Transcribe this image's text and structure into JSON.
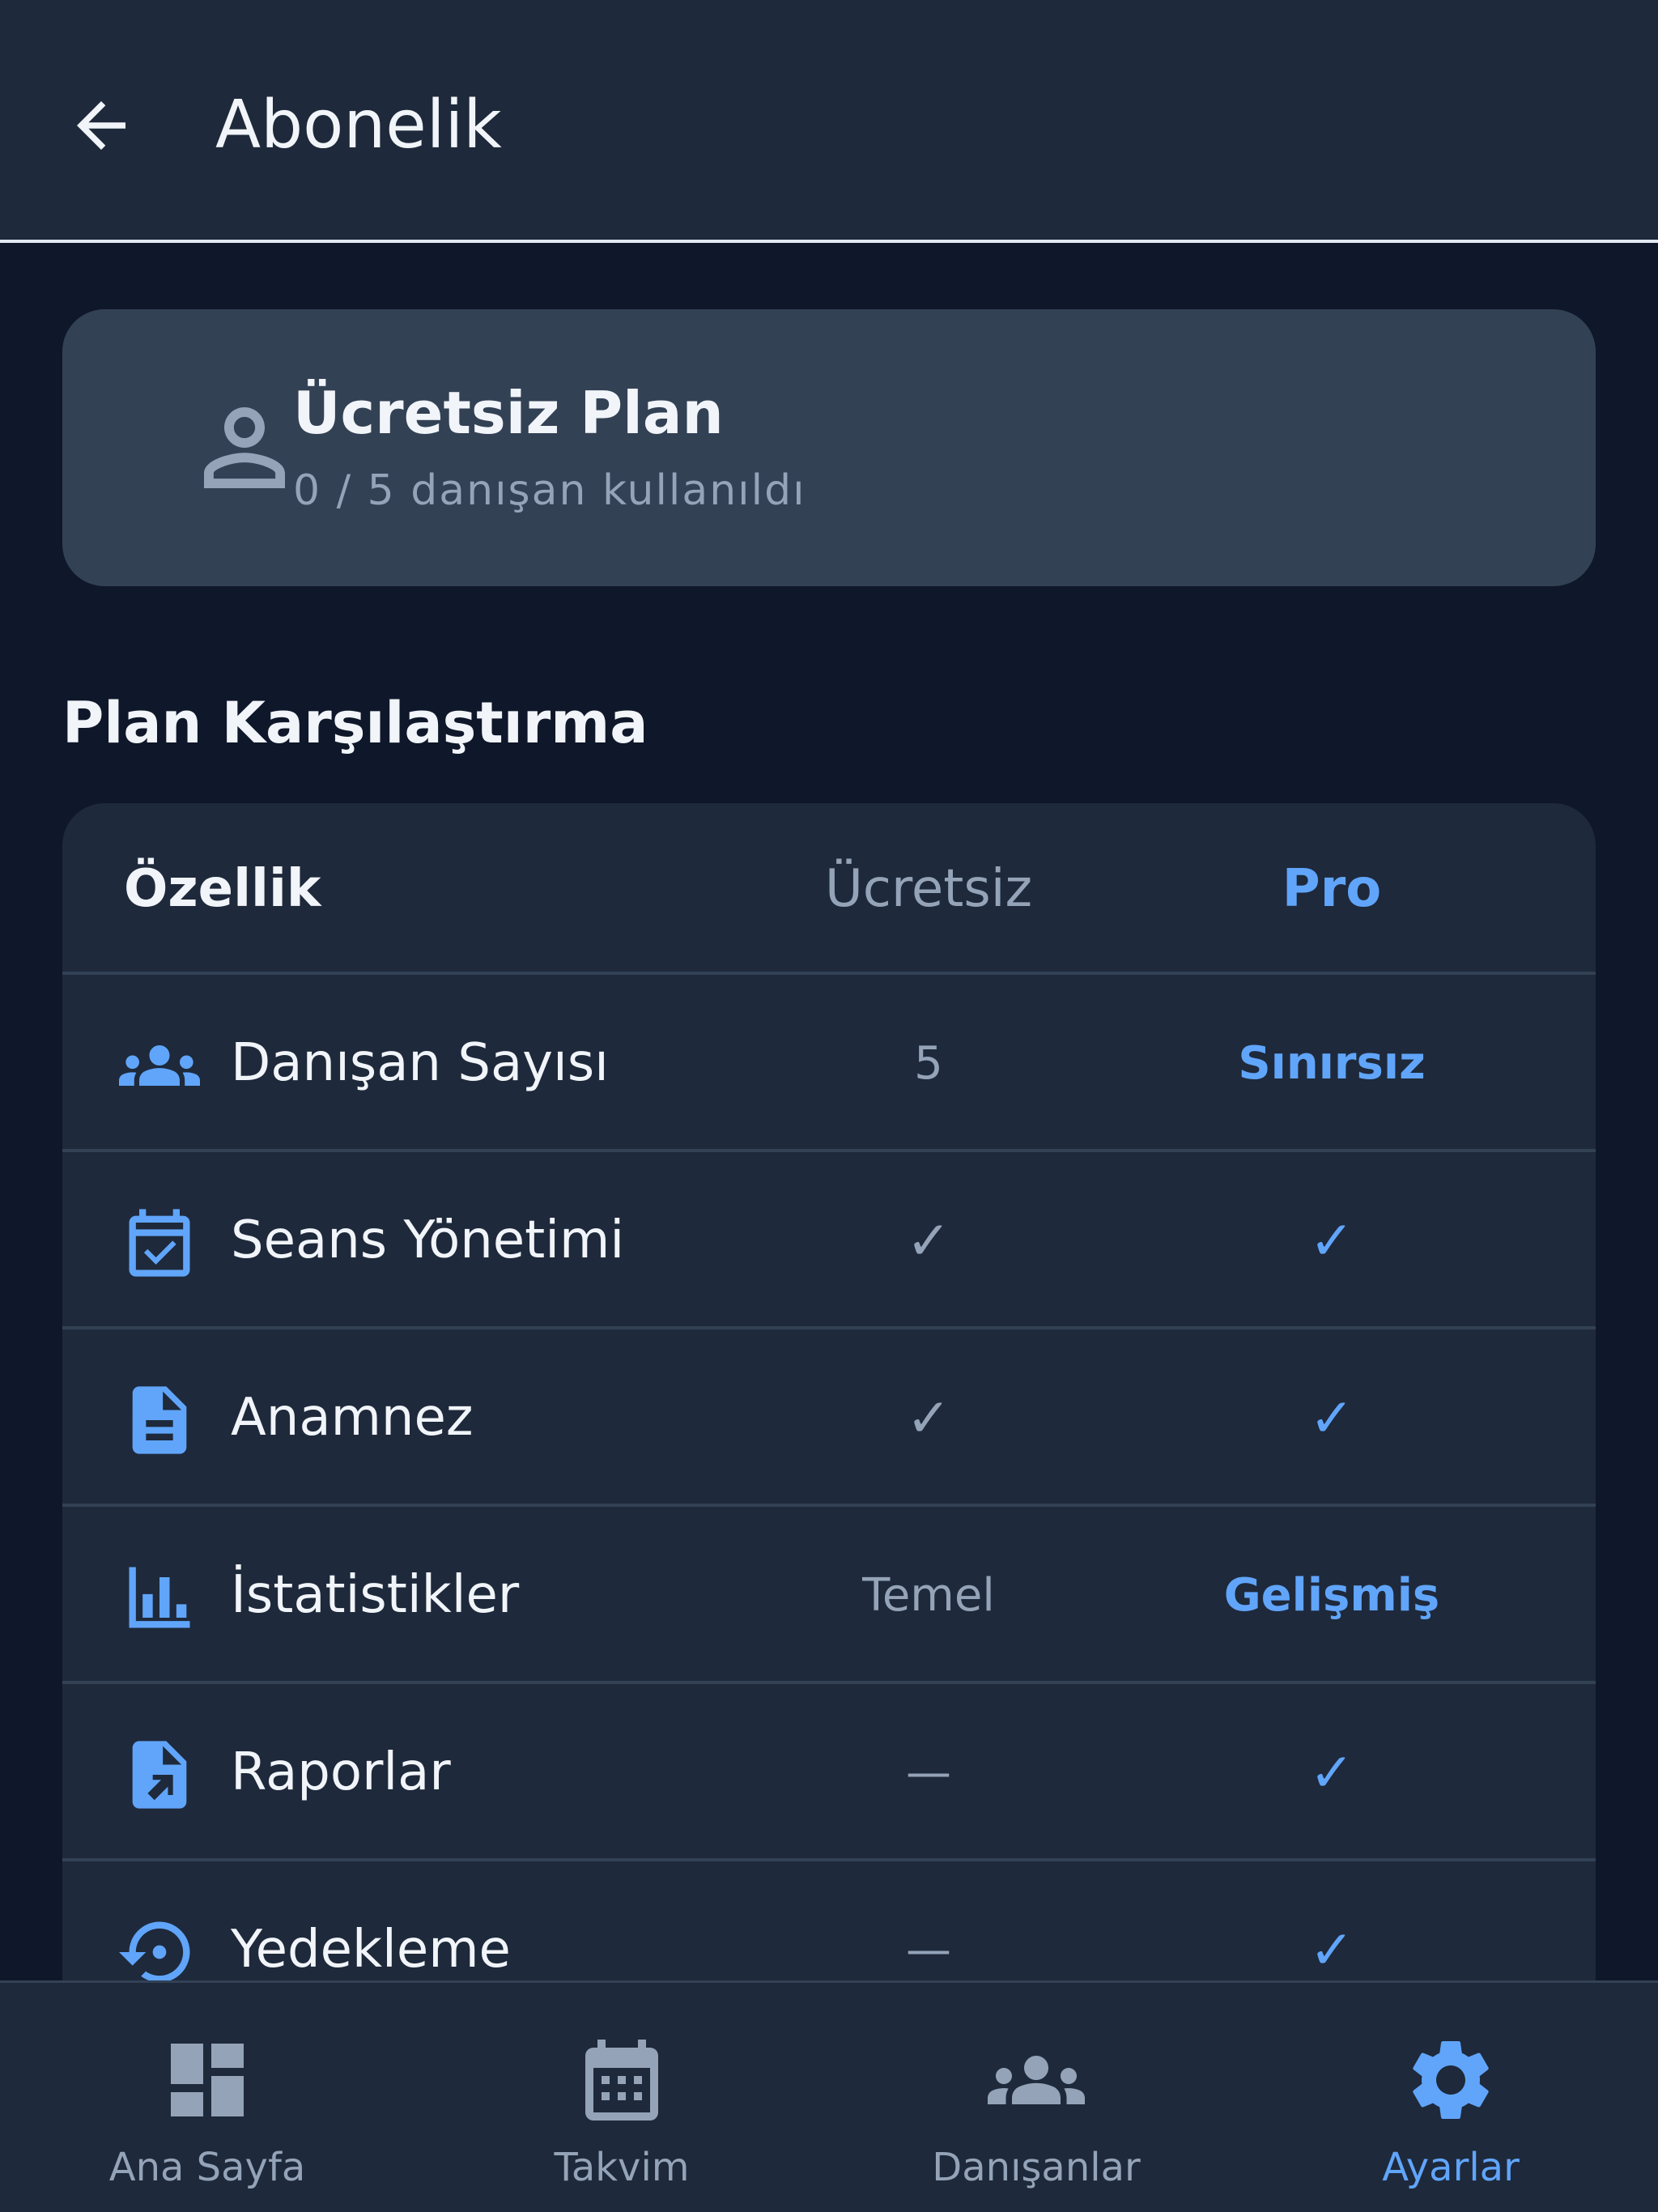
{
  "header": {
    "title": "Abonelik"
  },
  "plan_card": {
    "title": "Ücretsiz Plan",
    "usage": "0 / 5 danışan kullanıldı"
  },
  "comparison": {
    "section_title": "Plan Karşılaştırma",
    "columns": {
      "feature": "Özellik",
      "free": "Ücretsiz",
      "pro": "Pro"
    },
    "rows": [
      {
        "icon": "people-icon",
        "label": "Danışan Sayısı",
        "free": "5",
        "pro": "Sınırsız"
      },
      {
        "icon": "calendar-check-icon",
        "label": "Seans Yönetimi",
        "free": "✓",
        "pro": "✓"
      },
      {
        "icon": "document-icon",
        "label": "Anamnez",
        "free": "✓",
        "pro": "✓"
      },
      {
        "icon": "bar-chart-icon",
        "label": "İstatistikler",
        "free": "Temel",
        "pro": "Gelişmiş"
      },
      {
        "icon": "report-icon",
        "label": "Raporlar",
        "free": "—",
        "pro": "✓"
      },
      {
        "icon": "backup-restore-icon",
        "label": "Yedekleme",
        "free": "—",
        "pro": "✓"
      }
    ]
  },
  "bottom_nav": {
    "items": [
      {
        "label": "Ana Sayfa",
        "icon": "dashboard-icon",
        "active": false
      },
      {
        "label": "Takvim",
        "icon": "calendar-icon",
        "active": false
      },
      {
        "label": "Danışanlar",
        "icon": "people-icon",
        "active": false
      },
      {
        "label": "Ayarlar",
        "icon": "gear-icon",
        "active": true
      }
    ]
  },
  "colors": {
    "background": "#0f172a",
    "surface": "#1e293b",
    "card": "#334155",
    "accent": "#60a5fa",
    "muted": "#94a3b8",
    "text": "#f1f5f9"
  }
}
